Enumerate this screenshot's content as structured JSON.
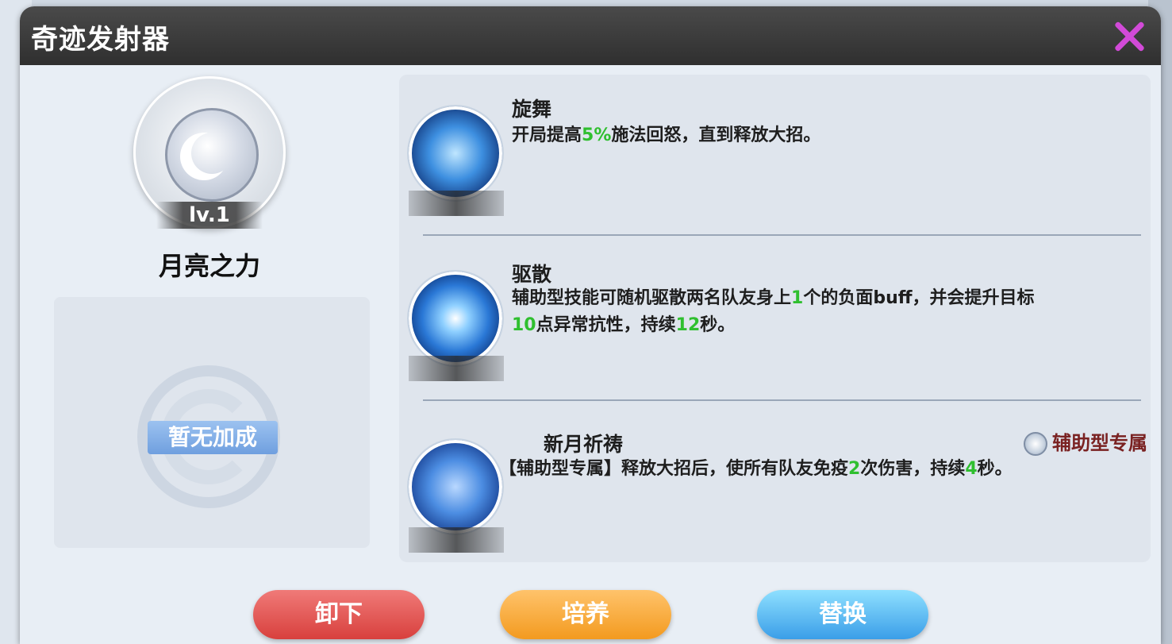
{
  "dialog": {
    "title": "奇迹发射器"
  },
  "item": {
    "level": "lv.1",
    "name": "月亮之力",
    "bonus_label": "暂无加成"
  },
  "skills": [
    {
      "name": "旋舞",
      "icon": "phoenix-skill-icon",
      "desc_parts": [
        "开局提高",
        "5%",
        "施法回怒，直到释放大招。"
      ]
    },
    {
      "name": "驱散",
      "icon": "burst-skill-icon",
      "desc_parts": [
        "辅助型技能可随机驱散两名队友身上",
        "1",
        "个的负面buff，并会提升目标",
        "10",
        "点异常抗性，持续",
        "12",
        "秒。"
      ]
    },
    {
      "name": "新月祈祷",
      "icon": "vortex-skill-icon",
      "exclusive_label": "辅助型专属",
      "desc_parts": [
        "【辅助型专属】释放大招后，使所有队友免疫",
        "2",
        "次伤害，持续",
        "4",
        "秒。"
      ]
    }
  ],
  "buttons": {
    "unload": "卸下",
    "train": "培养",
    "replace": "替换"
  },
  "colors": {
    "highlight": "#2fbf2f",
    "title_bar": "#3a3a3a",
    "close": "#d24ad8"
  }
}
